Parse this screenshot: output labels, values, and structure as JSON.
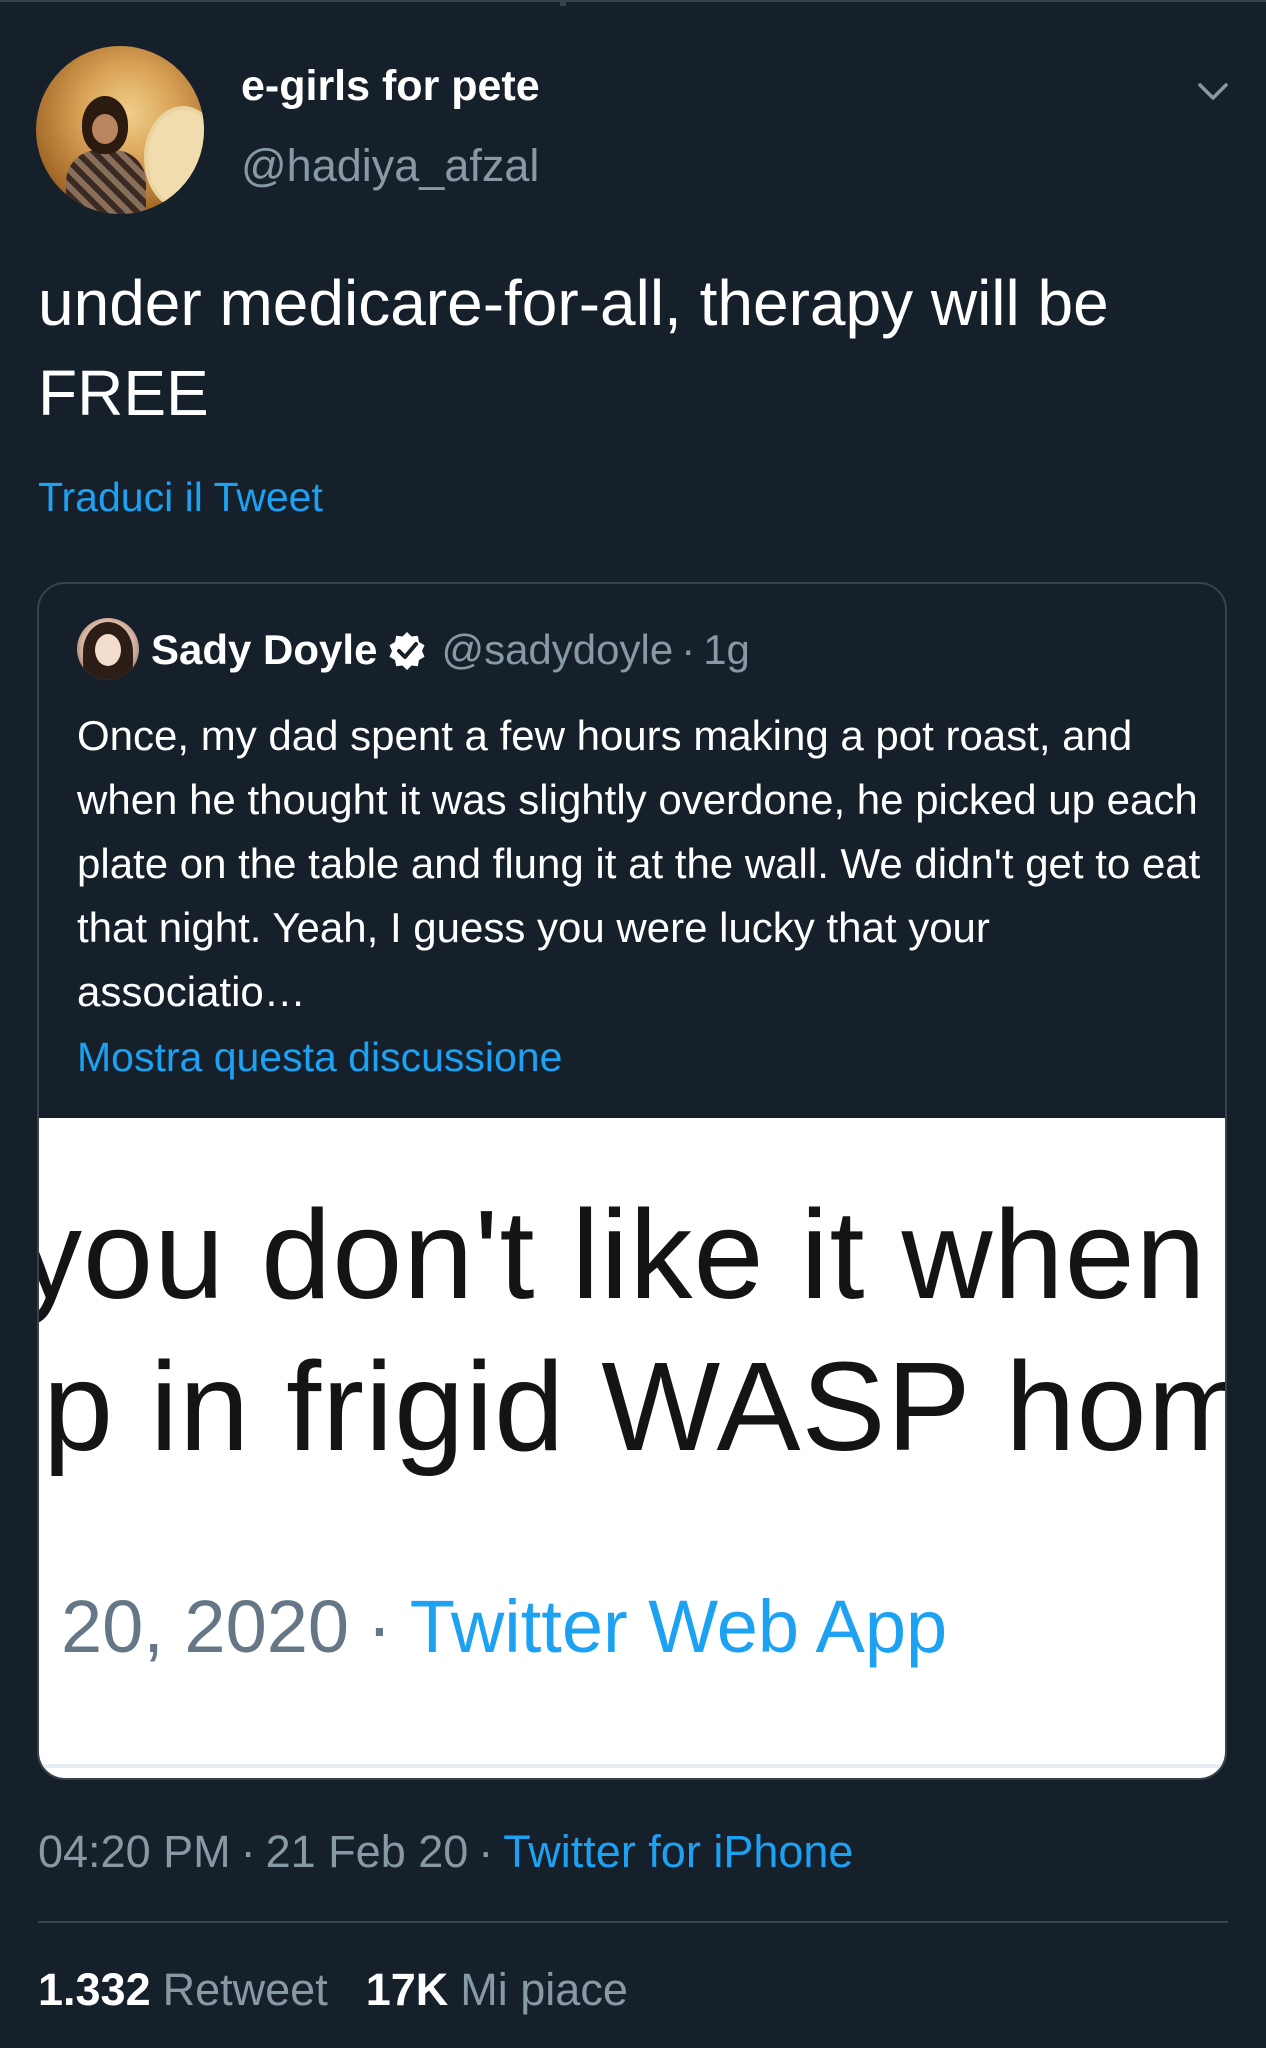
{
  "author": {
    "display_name": "e-girls for pete",
    "handle": "@hadiya_afzal"
  },
  "tweet": {
    "text": "under medicare-for-all, therapy will be FREE",
    "translate_label": "Traduci il Tweet"
  },
  "quoted_tweet": {
    "name": "Sady Doyle",
    "handle": "@sadydoyle",
    "separator": "·",
    "time": "1g",
    "text": "Once, my dad spent a few hours making a pot roast, and when he thought it was slightly overdone, he picked up each plate on the table and flung it at the wall. We didn't get to eat that night. Yeah, I guess you were lucky that your associatio…",
    "thread_link": "Mostra questa discussione",
    "image": {
      "line1": "you don't like it when Be",
      "line2": "p in frigid WASP homes",
      "date": "20, 2020",
      "separator": "·",
      "app": "Twitter Web App"
    }
  },
  "meta": {
    "time": "04:20 PM",
    "separator": "·",
    "date": "21 Feb 20",
    "source": "Twitter for iPhone"
  },
  "stats": {
    "retweets_count": "1.332",
    "retweets_label": "Retweet",
    "likes_count": "17K",
    "likes_label": "Mi piace"
  },
  "colors": {
    "background": "#15202b",
    "accent": "#1da1f2",
    "secondary_text": "#8899a6",
    "border": "#38444d"
  },
  "icons": {
    "more": "chevron-down-icon",
    "verified": "verified-badge-icon"
  }
}
